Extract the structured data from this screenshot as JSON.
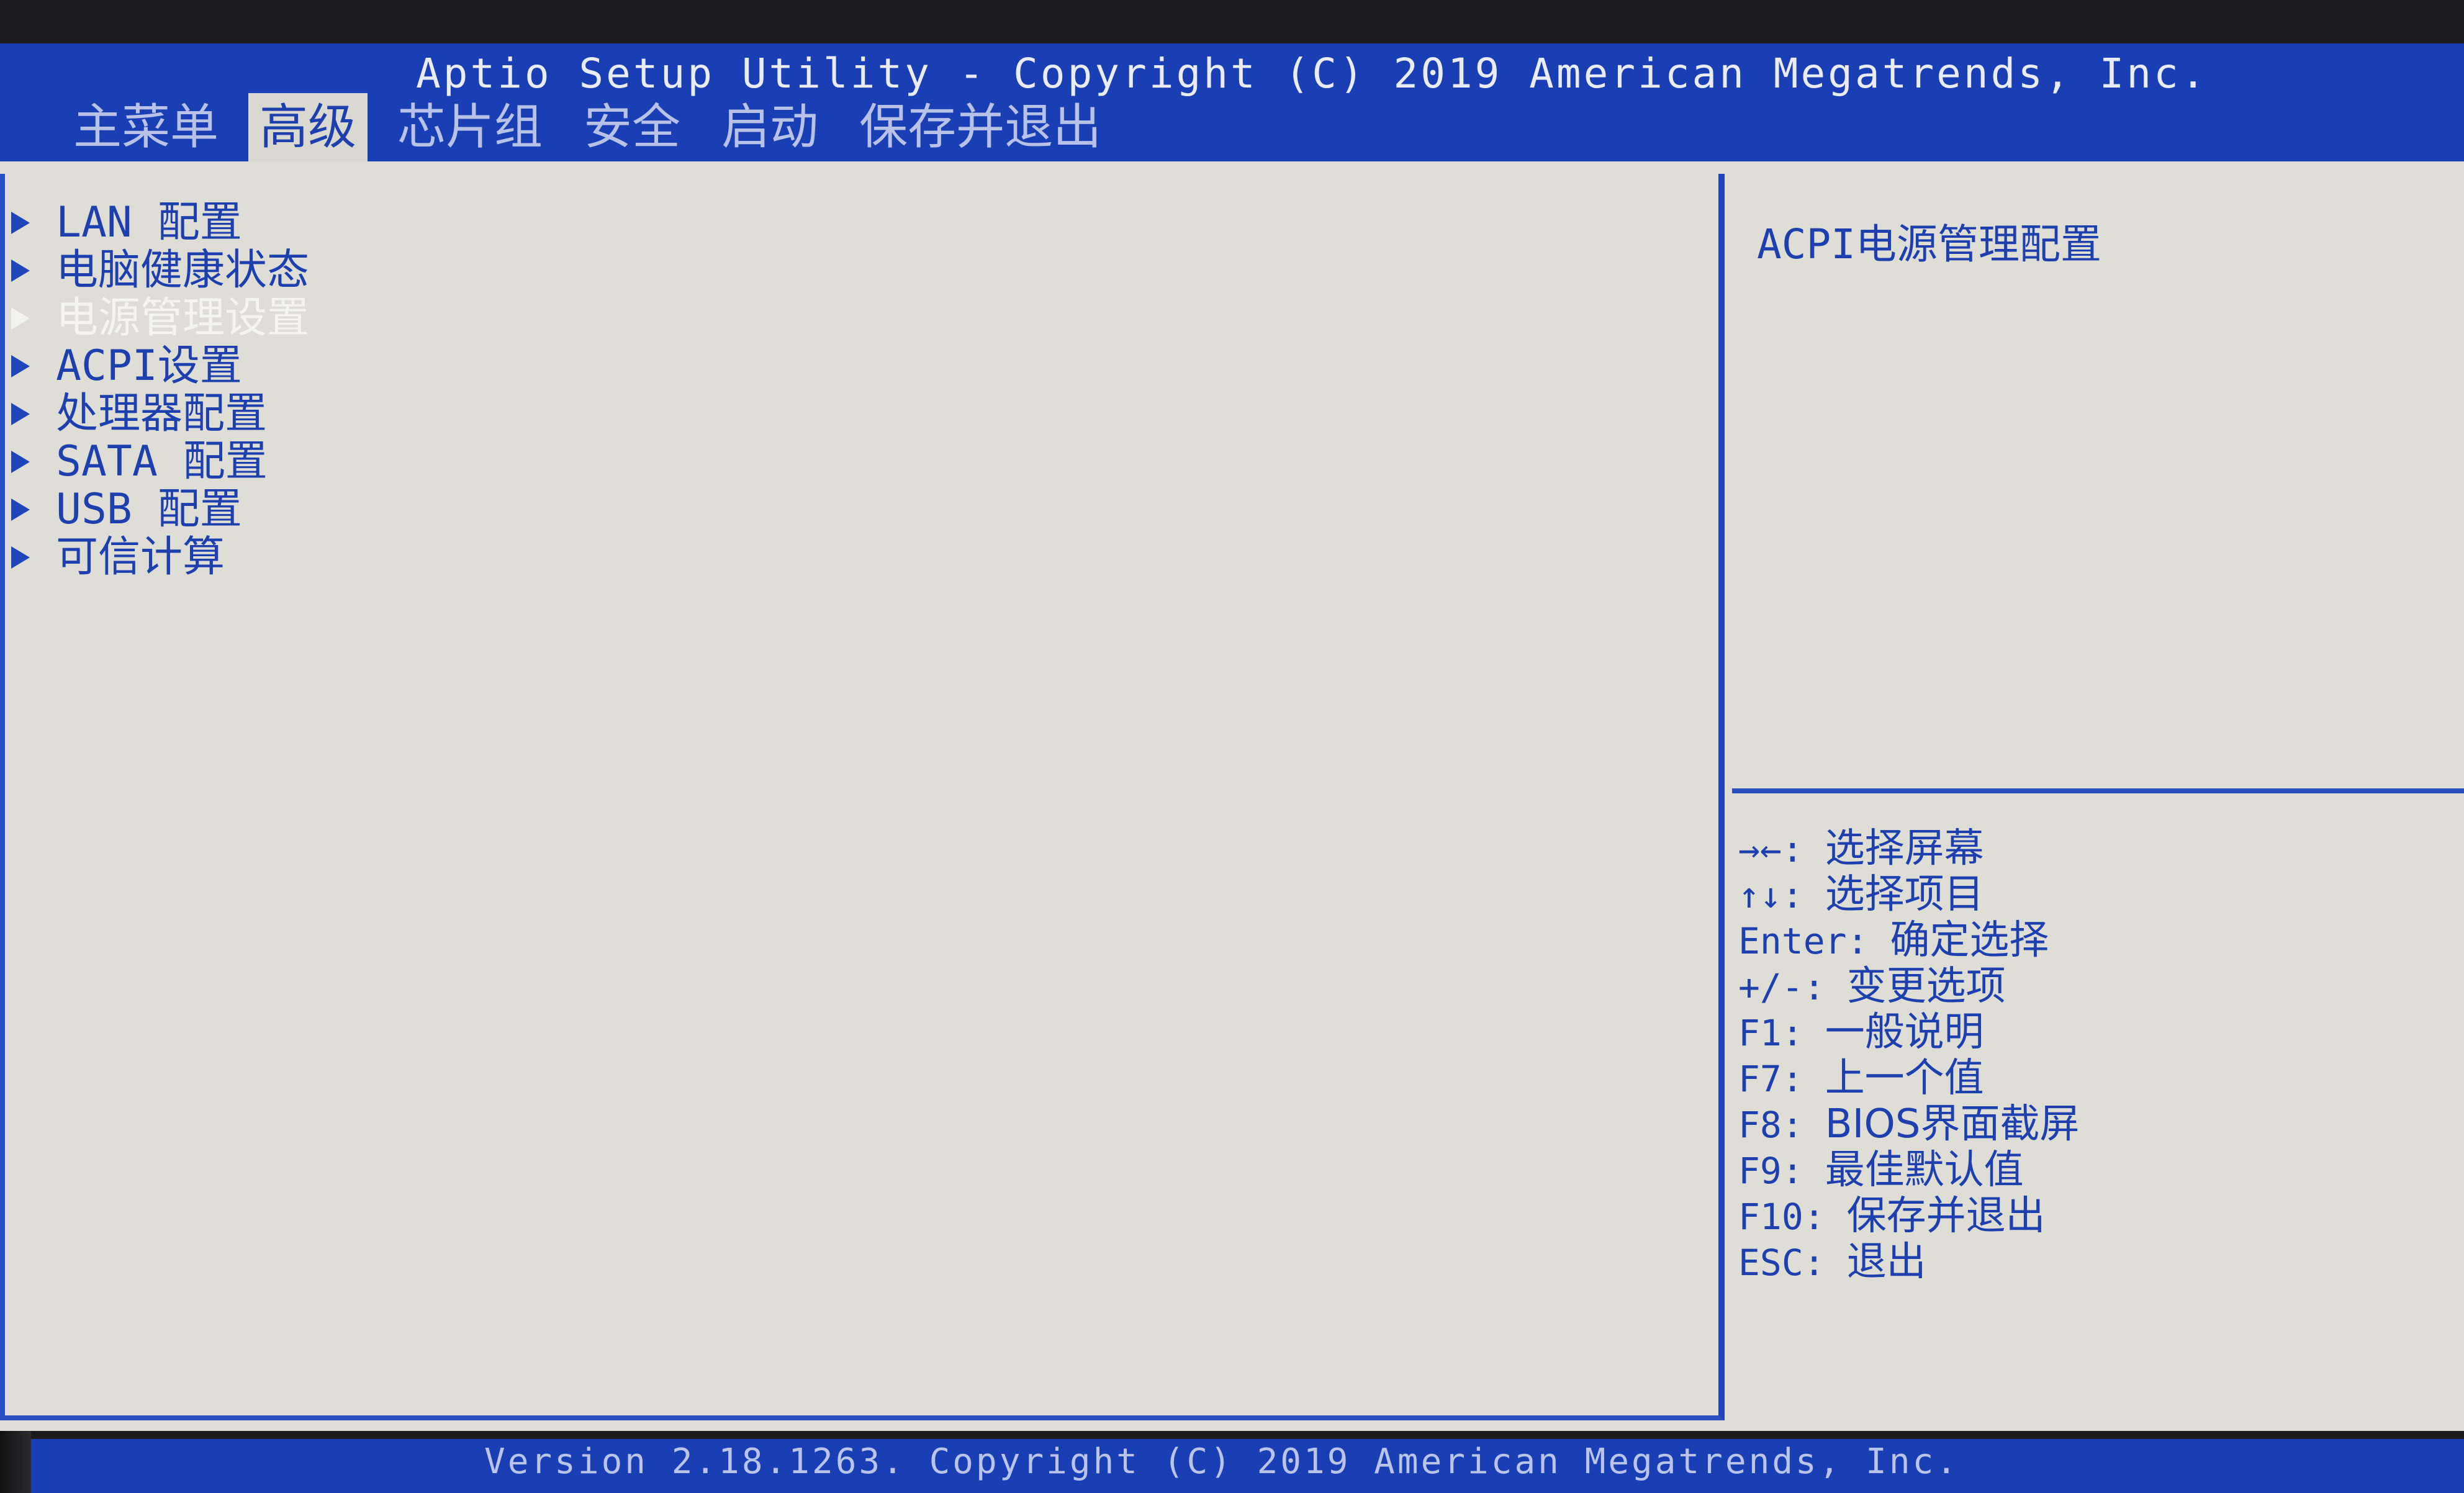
{
  "header": {
    "title": "Aptio Setup Utility - Copyright (C) 2019 American Megatrends, Inc."
  },
  "tabs": [
    {
      "label": "主菜单"
    },
    {
      "label": "高级"
    },
    {
      "label": "芯片组"
    },
    {
      "label": "安全"
    },
    {
      "label": "启动"
    },
    {
      "label": "保存并退出"
    }
  ],
  "active_tab": "高级",
  "menu": [
    {
      "label": "LAN 配置"
    },
    {
      "label": "电脑健康状态"
    },
    {
      "label": "电源管理设置"
    },
    {
      "label": "ACPI设置"
    },
    {
      "label": "处理器配置"
    },
    {
      "label": "SATA 配置"
    },
    {
      "label": "USB 配置"
    },
    {
      "label": "可信计算"
    }
  ],
  "selected_menu_item": "电源管理设置",
  "help": {
    "description": "ACPI电源管理配置"
  },
  "key_help": [
    {
      "key": "→←:",
      "desc": "选择屏幕"
    },
    {
      "key": "↑↓:",
      "desc": "选择项目"
    },
    {
      "key": "Enter:",
      "desc": "确定选择"
    },
    {
      "key": "+/-:",
      "desc": "变更选项"
    },
    {
      "key": "F1:",
      "desc": "一般说明"
    },
    {
      "key": "F7:",
      "desc": "上一个值"
    },
    {
      "key": "F8:",
      "desc": "BIOS界面截屏"
    },
    {
      "key": "F9:",
      "desc": "最佳默认值"
    },
    {
      "key": "F10:",
      "desc": "保存并退出"
    },
    {
      "key": "ESC:",
      "desc": "退出"
    }
  ],
  "footer": {
    "text": "Version 2.18.1263. Copyright (C) 2019 American Megatrends, Inc."
  },
  "colors": {
    "header_bg": "#1a3fb4",
    "body_bg": "#deded6",
    "accent_text": "#1e3fae",
    "selected_text": "#f4f4f0"
  }
}
